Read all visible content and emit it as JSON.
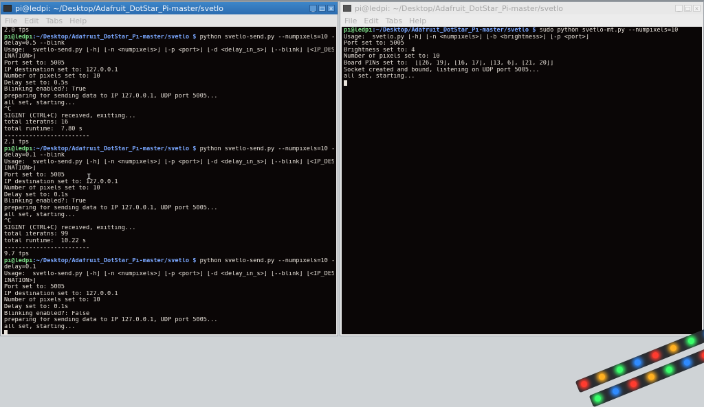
{
  "left_window": {
    "title": "pi@ledpi: ~/Desktop/Adafruit_DotStar_Pi-master/svetlo",
    "controls": [
      "_",
      "□",
      "×"
    ],
    "menu": [
      "File",
      "Edit",
      "Tabs",
      "Help"
    ],
    "prompt_user": "pi@ledpi",
    "prompt_path": ":~/Desktop/Adafruit_DotStar_Pi-master/svetlo $",
    "lines": [
      {
        "text": "2.0 fps"
      },
      {
        "prompt": true,
        "cmd": " python svetlo-send.py --numpixels=10 --"
      },
      {
        "text": "delay=0.5 --blink"
      },
      {
        "text": "Usage:  svetlo-send.py [-h] [-n <numpixels>] [-p <port>] [-d <delay_in_s>] [--blink] [<IP_DEST"
      },
      {
        "text": "INATION>]"
      },
      {
        "text": "Port set to: 5005"
      },
      {
        "text": "IP destination set to: 127.0.0.1"
      },
      {
        "text": "Number of pixels set to: 10"
      },
      {
        "text": "Delay set to: 0.5s"
      },
      {
        "text": "Blinking enabled?: True"
      },
      {
        "text": "preparing for sending data to IP 127.0.0.1, UDP port 5005..."
      },
      {
        "text": "all set, starting..."
      },
      {
        "text": "^C"
      },
      {
        "text": "SIGINT (CTRL+C) received, exitting..."
      },
      {
        "text": "total iteratns: 16"
      },
      {
        "text": "total runtime:  7.80 s"
      },
      {
        "text": "------------------------"
      },
      {
        "text": "2.1 fps"
      },
      {
        "prompt": true,
        "cmd": " python svetlo-send.py --numpixels=10 --"
      },
      {
        "text": "delay=0.1 --blink"
      },
      {
        "text": "Usage:  svetlo-send.py [-h] [-n <numpixels>] [-p <port>] [-d <delay_in_s>] [--blink] [<IP_DEST"
      },
      {
        "text": "INATION>]"
      },
      {
        "text": "Port set to: 5005"
      },
      {
        "text": "IP destination set to: 127.0.0.1"
      },
      {
        "text": "Number of pixels set to: 10"
      },
      {
        "text": "Delay set to: 0.1s"
      },
      {
        "text": "Blinking enabled?: True"
      },
      {
        "text": "preparing for sending data to IP 127.0.0.1, UDP port 5005..."
      },
      {
        "text": "all set, starting..."
      },
      {
        "text": "^C"
      },
      {
        "text": "SIGINT (CTRL+C) received, exitting..."
      },
      {
        "text": "total iteratns: 99"
      },
      {
        "text": "total runtime:  10.22 s"
      },
      {
        "text": "------------------------"
      },
      {
        "text": "9.7 fps"
      },
      {
        "prompt": true,
        "cmd": " python svetlo-send.py --numpixels=10 --"
      },
      {
        "text": "delay=0.1"
      },
      {
        "text": "Usage:  svetlo-send.py [-h] [-n <numpixels>] [-p <port>] [-d <delay_in_s>] [--blink] [<IP_DEST"
      },
      {
        "text": "INATION>]"
      },
      {
        "text": "Port set to: 5005"
      },
      {
        "text": "IP destination set to: 127.0.0.1"
      },
      {
        "text": "Number of pixels set to: 10"
      },
      {
        "text": "Delay set to: 0.1s"
      },
      {
        "text": "Blinking enabled?: False"
      },
      {
        "text": "preparing for sending data to IP 127.0.0.1, UDP port 5005..."
      },
      {
        "text": "all set, starting..."
      },
      {
        "cursor": true
      }
    ]
  },
  "right_window": {
    "title": "pi@ledpi: ~/Desktop/Adafruit_DotStar_Pi-master/svetlo",
    "controls": [
      "_",
      "□",
      "×"
    ],
    "menu": [
      "File",
      "Edit",
      "Tabs",
      "Help"
    ],
    "prompt_user": "pi@ledpi",
    "prompt_path": ":~/Desktop/Adafruit_DotStar_Pi-master/svetlo $",
    "lines": [
      {
        "prompt": true,
        "cmd": " sudo python svetlo-mt.py --numpixels=10"
      },
      {
        "text": "Usage:  svetlo.py [-h] [-n <numpixels>] [-b <brightness>] [-p <port>]"
      },
      {
        "text": "Port set to: 5005"
      },
      {
        "text": "Brightness set to: 4"
      },
      {
        "text": "Number of pixels set to: 10"
      },
      {
        "text": "Board PINs set to:  [[26, 19], [16, 17], [13, 6], [21, 20]]"
      },
      {
        "text": "Socket created and bound, listening on UDP port 5005..."
      },
      {
        "text": "all set, starting..."
      },
      {
        "cursor": true
      }
    ]
  },
  "colors": {
    "terminal_bg": "#0a0606",
    "terminal_fg": "#e8e2da",
    "prompt_user": "#7ee08a",
    "prompt_path": "#7aa7ff",
    "active_title": "#2b6cb0"
  },
  "led_colors": [
    "#ff3b2f",
    "#ffb020",
    "#39ff6a",
    "#2f8bff",
    "#ff3b2f",
    "#ffb020",
    "#39ff6a",
    "#2f8bff"
  ]
}
